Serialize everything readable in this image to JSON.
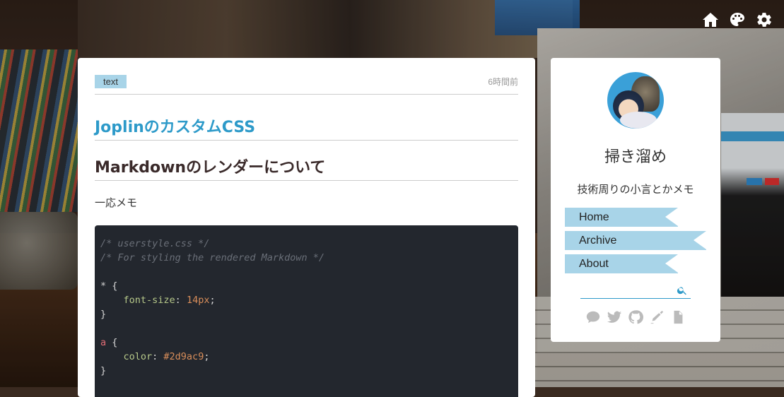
{
  "post": {
    "tag": "text",
    "time": "6時間前",
    "title": "JoplinのカスタムCSS",
    "heading": "Markdownのレンダーについて",
    "paragraph": "一応メモ",
    "code": {
      "comment1": "/* userstyle.css */",
      "comment2": "/* For styling the rendered Markdown */",
      "sel1": "*",
      "brace_open": " {",
      "prop1": "font-size",
      "colon": ": ",
      "val1": "14px",
      "semi": ";",
      "brace_close": "}",
      "sel2": "a",
      "prop2": "color",
      "val2": "#2d9ac9"
    }
  },
  "sidebar": {
    "title": "掃き溜め",
    "description": "技術周りの小言とかメモ",
    "nav": [
      {
        "label": "Home"
      },
      {
        "label": "Archive"
      },
      {
        "label": "About"
      }
    ],
    "search_placeholder": ""
  },
  "icons": {
    "top": [
      "home-icon",
      "palette-icon",
      "gear-icon"
    ],
    "social": [
      "chat-icon",
      "twitter-icon",
      "github-icon",
      "pen-icon",
      "document-icon"
    ]
  },
  "colors": {
    "accent": "#2d9ac9",
    "tag_bg": "#a8d4e8",
    "code_bg": "#23272e"
  }
}
